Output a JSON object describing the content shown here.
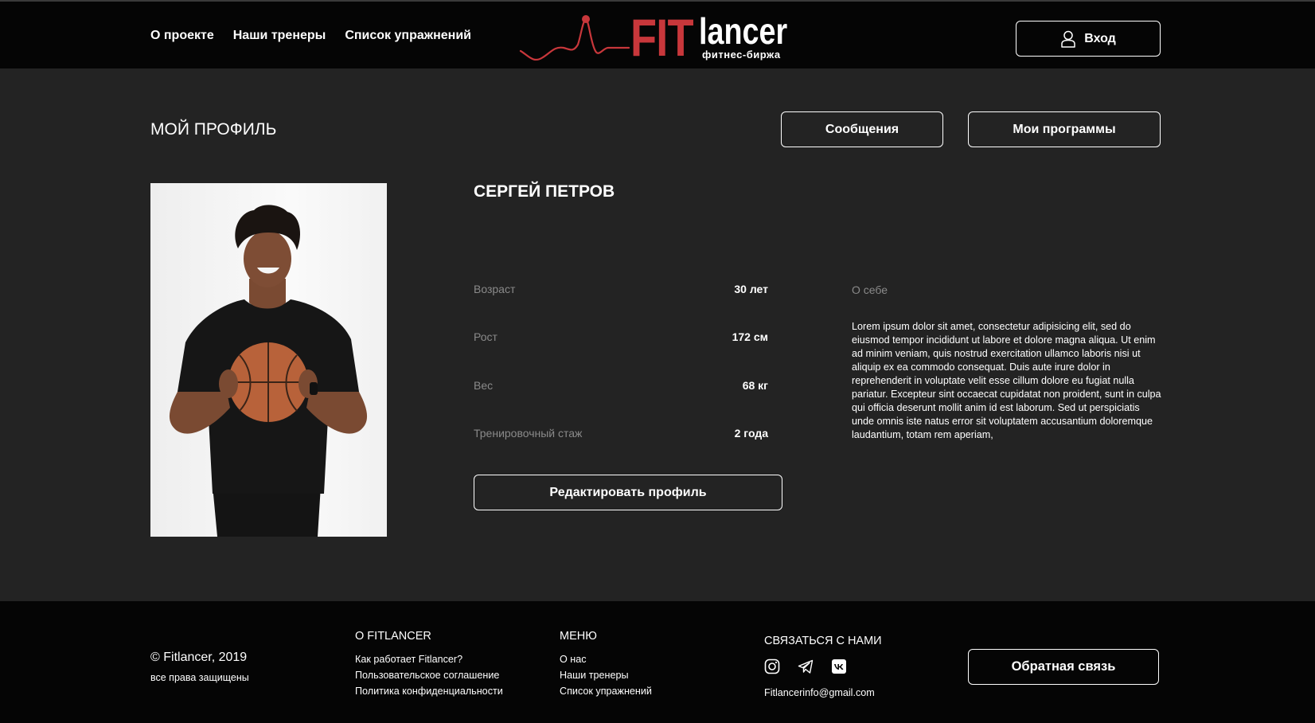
{
  "header": {
    "nav": [
      "О проекте",
      "Наши тренеры",
      "Список упражнений"
    ],
    "logo": {
      "fit": "FIT",
      "lancer": "lancer",
      "subtitle": "фитнес-биржа"
    },
    "login_label": "Вход"
  },
  "profile": {
    "page_title": "МОЙ ПРОФИЛЬ",
    "messages_label": "Сообщения",
    "programs_label": "Мои программы",
    "name": "СЕРГЕЙ ПЕТРОВ",
    "stats": [
      {
        "label": "Возраст",
        "value": "30 лет"
      },
      {
        "label": "Рост",
        "value": "172 см"
      },
      {
        "label": "Вес",
        "value": "68 кг"
      },
      {
        "label": "Тренировочный стаж",
        "value": "2 года"
      }
    ],
    "about_label": "О себе",
    "about_text": "Lorem ipsum dolor sit amet, consectetur adipisicing elit, sed do eiusmod tempor incididunt ut labore et dolore magna aliqua. Ut enim ad minim veniam, quis nostrud exercitation ullamco laboris nisi ut aliquip ex ea commodo consequat. Duis aute irure dolor in reprehenderit in voluptate velit esse cillum dolore eu fugiat nulla pariatur. Excepteur sint occaecat cupidatat non proident, sunt in culpa qui officia deserunt mollit anim id est laborum. Sed ut perspiciatis unde omnis iste natus error sit voluptatem accusantium doloremque laudantium, totam rem aperiam,",
    "edit_label": "Редактировать профиль"
  },
  "footer": {
    "copyright": "© Fitlancer, 2019",
    "rights": "все права защищены",
    "about": {
      "title": "О FITLANCER",
      "links": [
        "Как работает Fitlancer?",
        "Пользовательское соглашение",
        "Политика конфиденциальности"
      ]
    },
    "menu": {
      "title": "МЕНЮ",
      "links": [
        "О нас",
        "Наши тренеры",
        "Список упражнений"
      ]
    },
    "contact": {
      "title": "СВЯЗАТЬСЯ С НАМИ",
      "icons": [
        "instagram-icon",
        "telegram-icon",
        "vk-icon"
      ],
      "email": "Fitlancerinfo@gmail.com"
    },
    "feedback_label": "Обратная связь"
  },
  "colors": {
    "accent": "#c8373b",
    "header_bg": "#050505",
    "page_bg": "#232323",
    "muted": "#8a8a8a"
  }
}
